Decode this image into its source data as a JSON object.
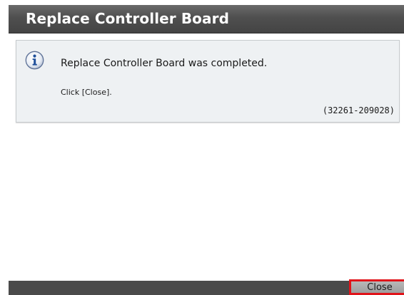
{
  "dialog": {
    "title": "Replace Controller Board"
  },
  "message": {
    "icon": "info-icon",
    "text": "Replace Controller Board was completed.",
    "instruction": "Click [Close].",
    "code": "(32261-209028)"
  },
  "footer": {
    "close_label": "Close"
  },
  "colors": {
    "title_bar": "#4f4f4f",
    "message_bg": "#eef1f3",
    "icon_blue": "#1f4f9a",
    "highlight": "#e0141a"
  }
}
